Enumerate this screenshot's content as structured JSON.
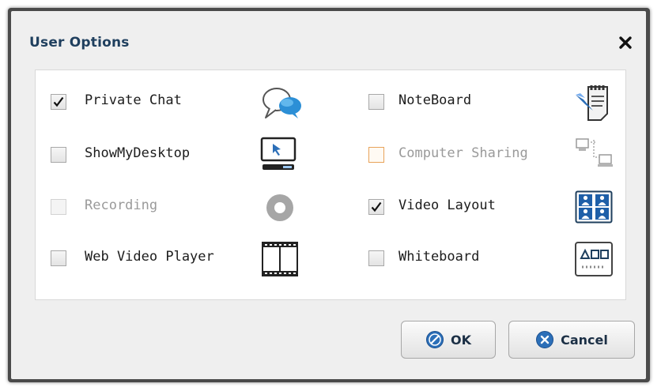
{
  "dialog": {
    "title": "User Options",
    "close_icon": "close-icon"
  },
  "options": [
    {
      "label": "Private Chat",
      "checked": true,
      "enabled": true,
      "icon": "chat-bubbles-icon"
    },
    {
      "label": "NoteBoard",
      "checked": false,
      "enabled": true,
      "icon": "noteboard-icon"
    },
    {
      "label": "ShowMyDesktop",
      "checked": false,
      "enabled": true,
      "icon": "desktop-share-icon"
    },
    {
      "label": "Computer Sharing",
      "checked": false,
      "enabled": false,
      "icon": "computer-sharing-icon"
    },
    {
      "label": "Recording",
      "checked": false,
      "enabled": false,
      "icon": "recording-disc-icon"
    },
    {
      "label": "Video Layout",
      "checked": true,
      "enabled": true,
      "icon": "video-layout-icon"
    },
    {
      "label": "Web Video Player",
      "checked": false,
      "enabled": true,
      "icon": "film-strip-icon"
    },
    {
      "label": "Whiteboard",
      "checked": false,
      "enabled": true,
      "icon": "whiteboard-icon"
    }
  ],
  "buttons": {
    "ok_label": "OK",
    "cancel_label": "Cancel"
  },
  "colors": {
    "title": "#1f3f5e",
    "accent_blue": "#2c6fb8",
    "highlight_orange": "#e8a35a"
  }
}
